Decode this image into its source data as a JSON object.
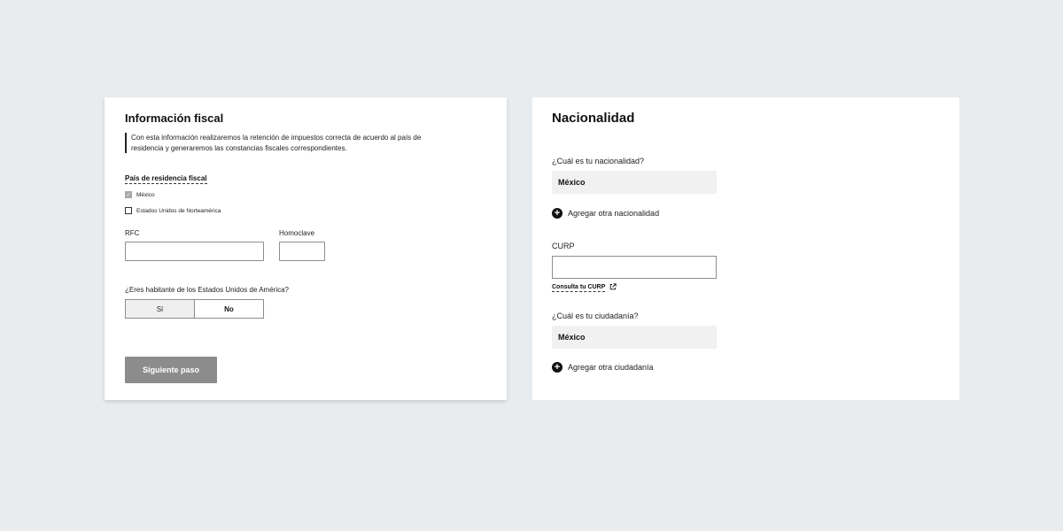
{
  "fiscal": {
    "title": "Información fiscal",
    "description": "Con esta información realizaremos la retención de impuestos correcta de acuerdo al país de residencia y generaremos las constancias fiscales correspondientes.",
    "country_label": "País de residencia fiscal",
    "options": [
      {
        "label": "México",
        "checked": true
      },
      {
        "label": "Estados Unidos de Norteamérica",
        "checked": false
      }
    ],
    "rfc_label": "RFC",
    "rfc_value": "",
    "homoclave_label": "Homoclave",
    "homoclave_value": "",
    "us_question": "¿Eres habitante de los Estados Unidos de América?",
    "yes_label": "Sí",
    "no_label": "No",
    "selected_answer": "No",
    "next_label": "Siguiente paso"
  },
  "nationality": {
    "title": "Nacionalidad",
    "nationality_question": "¿Cuál es tu nacionalidad?",
    "nationality_value": "México",
    "add_nationality": "Agregar otra nacionalidad",
    "curp_label": "CURP",
    "curp_value": "",
    "curp_link": "Consulta tu CURP",
    "citizenship_question": "¿Cuál es tu ciudadanía?",
    "citizenship_value": "México",
    "add_citizenship": "Agregar otra ciudadanía"
  },
  "icons": {
    "checkbox_checked": "check-icon",
    "add": "plus-circle-icon",
    "external": "external-link-icon"
  },
  "colors": {
    "background": "#e8ecef",
    "card": "#ffffff",
    "primary_disabled": "#8c8c8c",
    "select_fill": "#f1f1f1"
  }
}
